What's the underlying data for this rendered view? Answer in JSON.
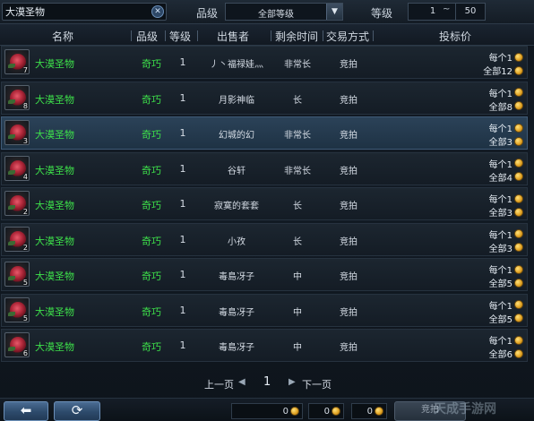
{
  "filters": {
    "search_value": "大漠圣物",
    "clear_icon": "close-icon",
    "grade_label": "品级",
    "grade_selected": "全部等级",
    "level_label": "等级",
    "level_min": "1",
    "level_separator": "~",
    "level_max": "50"
  },
  "columns": {
    "name": "名称",
    "quality": "品级",
    "level": "等级",
    "seller": "出售者",
    "time_left": "剩余时间",
    "trade_mode": "交易方式",
    "bid_price": "投标价"
  },
  "rows": [
    {
      "stack": "7",
      "name": "大漠圣物",
      "quality": "奇巧",
      "level": "1",
      "seller": "丿丶福禄娃灬",
      "time_left": "非常长",
      "trade_mode": "竞拍",
      "price_each": "每个1",
      "price_total": "全部12"
    },
    {
      "stack": "8",
      "name": "大漠圣物",
      "quality": "奇巧",
      "level": "1",
      "seller": "月影神临",
      "time_left": "长",
      "trade_mode": "竞拍",
      "price_each": "每个1",
      "price_total": "全部8"
    },
    {
      "stack": "3",
      "name": "大漠圣物",
      "quality": "奇巧",
      "level": "1",
      "seller": "幻城的幻",
      "time_left": "非常长",
      "trade_mode": "竞拍",
      "price_each": "每个1",
      "price_total": "全部3"
    },
    {
      "stack": "4",
      "name": "大漠圣物",
      "quality": "奇巧",
      "level": "1",
      "seller": "谷轩",
      "time_left": "非常长",
      "trade_mode": "竞拍",
      "price_each": "每个1",
      "price_total": "全部4"
    },
    {
      "stack": "2",
      "name": "大漠圣物",
      "quality": "奇巧",
      "level": "1",
      "seller": "寂寞的套套",
      "time_left": "长",
      "trade_mode": "竞拍",
      "price_each": "每个1",
      "price_total": "全部3"
    },
    {
      "stack": "2",
      "name": "大漠圣物",
      "quality": "奇巧",
      "level": "1",
      "seller": "小孜",
      "time_left": "长",
      "trade_mode": "竞拍",
      "price_each": "每个1",
      "price_total": "全部3"
    },
    {
      "stack": "5",
      "name": "大漠圣物",
      "quality": "奇巧",
      "level": "1",
      "seller": "毒島冴子",
      "time_left": "中",
      "trade_mode": "竞拍",
      "price_each": "每个1",
      "price_total": "全部5"
    },
    {
      "stack": "5",
      "name": "大漠圣物",
      "quality": "奇巧",
      "level": "1",
      "seller": "毒島冴子",
      "time_left": "中",
      "trade_mode": "竞拍",
      "price_each": "每个1",
      "price_total": "全部5"
    },
    {
      "stack": "6",
      "name": "大漠圣物",
      "quality": "奇巧",
      "level": "1",
      "seller": "毒島冴子",
      "time_left": "中",
      "trade_mode": "竞拍",
      "price_each": "每个1",
      "price_total": "全部6"
    }
  ],
  "selected_row": 2,
  "pager": {
    "prev": "上一页",
    "page": "1",
    "next": "下一页"
  },
  "toolbar": {
    "back_icon": "back-arrow-icon",
    "refresh_icon": "refresh-icon",
    "money_gold": "0",
    "money_silver": "0",
    "money_copper": "0",
    "bid_button": "竞拍"
  },
  "watermark": "天成手游网",
  "colors": {
    "item_name": "#3de04a",
    "selected_row": "#2b4258",
    "coin": "#e0a020"
  }
}
